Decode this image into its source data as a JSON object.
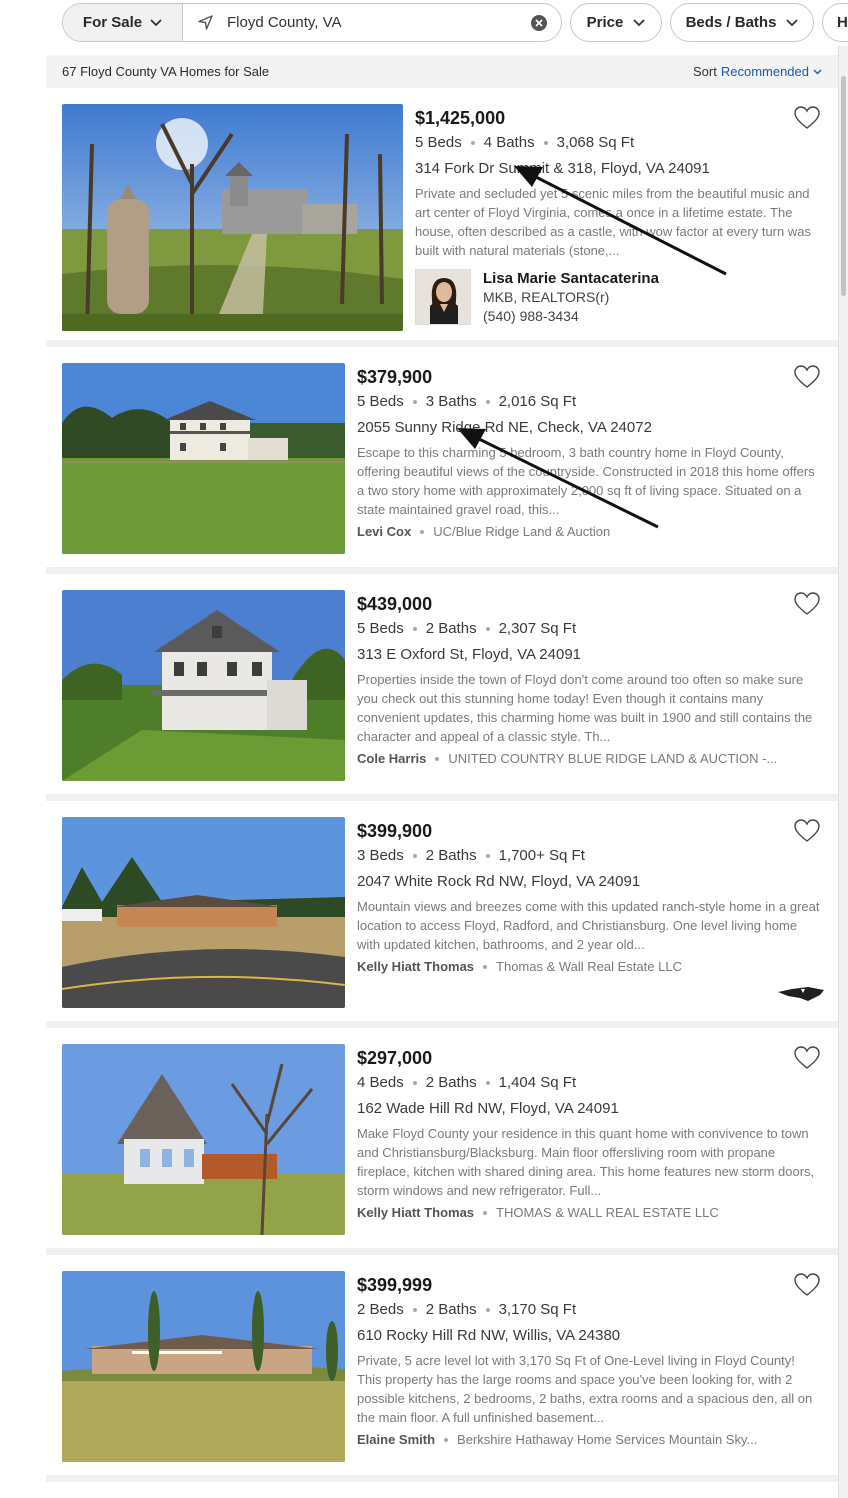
{
  "filters": {
    "for_sale_label": "For Sale",
    "search_value": "Floyd County, VA",
    "price_label": "Price",
    "beds_baths_label": "Beds / Baths",
    "more_label": "H"
  },
  "results": {
    "count_text": "67 Floyd County VA Homes for Sale",
    "sort_label": "Sort",
    "sort_value": "Recommended"
  },
  "listings": [
    {
      "price": "$1,425,000",
      "beds": "5 Beds",
      "baths": "4 Baths",
      "sqft": "3,068 Sq Ft",
      "address": "314 Fork Dr Summit & 318, Floyd, VA 24091",
      "description": "Private and secluded yet 5 scenic miles from the beautiful music and art center of Floyd Virginia, comes a once in a lifetime estate. The house, often described as a castle, with wow factor at every turn was built with natural materials (stone,...",
      "agent_name": "Lisa Marie Santacaterina",
      "agent_company": "MKB, REALTORS(r)",
      "agent_phone": "(540) 988-3434"
    },
    {
      "price": "$379,900",
      "beds": "5 Beds",
      "baths": "3 Baths",
      "sqft": "2,016 Sq Ft",
      "address": "2055 Sunny Ridge Rd NE, Check, VA 24072",
      "description": "Escape to this charming 5 bedroom, 3 bath country home in Floyd County, offering beautiful views of the countryside. Constructed in 2018 this home offers a two story home with approximately 2,000 sq ft of living space. Situated on a state maintained gravel road, this...",
      "agent_name": "Levi Cox",
      "agent_company": "UC/Blue Ridge Land & Auction"
    },
    {
      "price": "$439,000",
      "beds": "5 Beds",
      "baths": "2 Baths",
      "sqft": "2,307 Sq Ft",
      "address": "313 E Oxford St, Floyd, VA 24091",
      "description": "Properties inside the town of Floyd don't come around too often so make sure you check out this stunning home today! Even though it contains many convenient updates, this charming home was built in 1900 and still contains the character and appeal of a classic style. Th...",
      "agent_name": "Cole Harris",
      "agent_company": "UNITED COUNTRY BLUE RIDGE LAND & AUCTION -..."
    },
    {
      "price": "$399,900",
      "beds": "3 Beds",
      "baths": "2 Baths",
      "sqft": "1,700+ Sq Ft",
      "address": "2047 White Rock Rd NW, Floyd, VA 24091",
      "description": "Mountain views and breezes come with this updated ranch-style home in a great location to access Floyd, Radford, and Christiansburg. One level living home with updated kitchen, bathrooms, and 2 year old...",
      "agent_name": "Kelly Hiatt Thomas",
      "agent_company": "Thomas & Wall Real Estate LLC"
    },
    {
      "price": "$297,000",
      "beds": "4 Beds",
      "baths": "2 Baths",
      "sqft": "1,404 Sq Ft",
      "address": "162 Wade Hill Rd NW, Floyd, VA 24091",
      "description": "Make Floyd County your residence in this quant home with convivence to town and Christiansburg/Blacksburg. Main floor offersliving room with propane fireplace, kitchen with shared dining area. This home features new storm doors, storm windows and new refrigerator. Full...",
      "agent_name": "Kelly Hiatt Thomas",
      "agent_company": "THOMAS & WALL REAL ESTATE LLC"
    },
    {
      "price": "$399,999",
      "beds": "2 Beds",
      "baths": "2 Baths",
      "sqft": "3,170 Sq Ft",
      "address": "610 Rocky Hill Rd NW, Willis, VA 24380",
      "description": "Private, 5 acre level lot with 3,170 Sq Ft of One-Level living in Floyd County! This property has the large rooms and space you've been looking for, with 2 possible kitchens, 2 bedrooms, 2 baths, extra rooms and a spacious den, all on the main floor. A full unfinished basement...",
      "agent_name": "Elaine Smith",
      "agent_company": "Berkshire Hathaway Home Services Mountain Sky..."
    }
  ]
}
